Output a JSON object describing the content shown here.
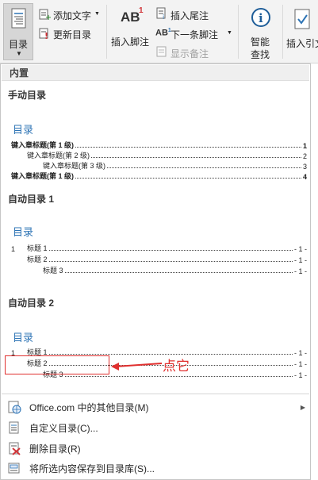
{
  "ribbon": {
    "toc_label": "目录",
    "add_text_label": "添加文字",
    "update_toc_label": "更新目录",
    "insert_footnote_label": "插入脚注",
    "insert_endnote_label": "插入尾注",
    "next_footnote_label": "下一条脚注",
    "show_notes_label": "显示备注",
    "smart_lookup_label_1": "智能",
    "smart_lookup_label_2": "查找",
    "insert_citation_label": "插入引文"
  },
  "gallery": {
    "section_header": "内置",
    "groups": [
      {
        "title": "手动目录",
        "toc_heading": "目录",
        "lines": [
          {
            "text": "键入章标题(第 1 级)",
            "page": "1"
          },
          {
            "text": "键入章标题(第 2 级)",
            "page": "2"
          },
          {
            "text": "键入章标题(第 3 级)",
            "page": "3"
          },
          {
            "text": "键入章标题(第 1 级)",
            "page": "4"
          }
        ]
      },
      {
        "title": "自动目录 1",
        "toc_heading": "目录",
        "lines": [
          {
            "num": "1",
            "text": "标题 1",
            "page": "- 1 -"
          },
          {
            "text": "标题 2",
            "page": "- 1 -"
          },
          {
            "text": "标题 3",
            "page": "- 1 -"
          }
        ]
      },
      {
        "title": "自动目录 2",
        "toc_heading": "目录",
        "lines": [
          {
            "num": "1",
            "text": "标题 1",
            "page": "- 1 -"
          },
          {
            "text": "标题 2",
            "page": "- 1 -"
          },
          {
            "text": "标题 3",
            "page": "- 1 -"
          }
        ]
      }
    ]
  },
  "menu": {
    "more_tocs": "Office.com 中的其他目录(M)",
    "custom_toc": "自定义目录(C)...",
    "remove_toc": "删除目录(R)",
    "save_selection": "将所选内容保存到目录库(S)..."
  },
  "annotation": {
    "note_text": "点它",
    "color": "#e0302f"
  }
}
